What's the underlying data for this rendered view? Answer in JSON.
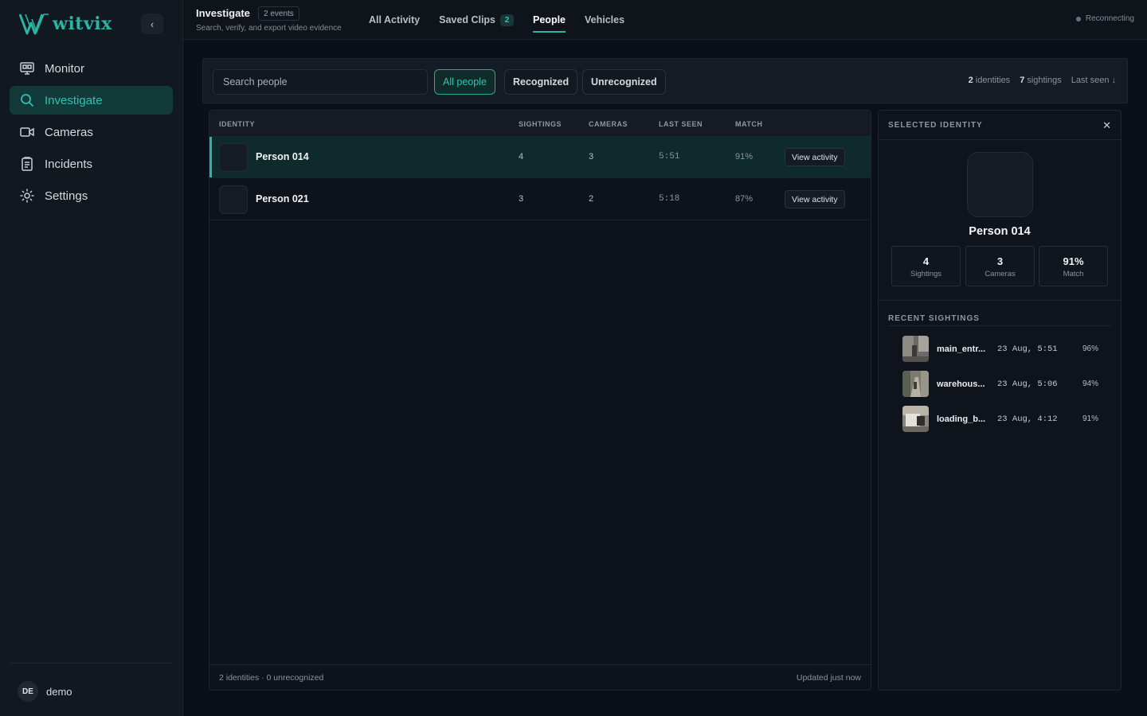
{
  "app": {
    "brand": "witvix"
  },
  "sidebar": {
    "items": [
      {
        "label": "Monitor",
        "icon": "monitor-icon"
      },
      {
        "label": "Investigate",
        "icon": "search-icon",
        "active": true
      },
      {
        "label": "Cameras",
        "icon": "camera-icon"
      },
      {
        "label": "Incidents",
        "icon": "clipboard-icon"
      },
      {
        "label": "Settings",
        "icon": "gear-icon"
      }
    ],
    "user": {
      "initials": "DE",
      "name": "demo"
    }
  },
  "header": {
    "title": "Investigate",
    "events_badge": "2 events",
    "subtitle": "Search, verify, and export video evidence",
    "tabs": [
      {
        "label": "All Activity"
      },
      {
        "label": "Saved Clips",
        "count": "2"
      },
      {
        "label": "People",
        "active": true
      },
      {
        "label": "Vehicles"
      }
    ],
    "status": "Reconnecting"
  },
  "filters": {
    "search_placeholder": "Search people",
    "search_value": "",
    "options": [
      "All people",
      "Recognized",
      "Unrecognized"
    ],
    "active": "All people",
    "summary": {
      "identities_count": "2",
      "identities_label": "identities",
      "sightings_count": "7",
      "sightings_label": "sightings",
      "sort": "Last seen ↓"
    }
  },
  "table": {
    "headers": {
      "identity": "IDENTITY",
      "sightings": "SIGHTINGS",
      "cameras": "CAMERAS",
      "last_seen": "LAST SEEN",
      "match": "MATCH"
    },
    "rows": [
      {
        "name": "Person 014",
        "sightings": "4",
        "cameras": "3",
        "last_seen": "5:51",
        "match": "91%",
        "action": "View activity",
        "selected": true
      },
      {
        "name": "Person 021",
        "sightings": "3",
        "cameras": "2",
        "last_seen": "5:18",
        "match": "87%",
        "action": "View activity",
        "selected": false
      }
    ],
    "footer_left": "2 identities · 0 unrecognized",
    "footer_right": "Updated just now"
  },
  "detail": {
    "title": "SELECTED IDENTITY",
    "name": "Person 014",
    "stats": [
      {
        "value": "4",
        "label": "Sightings"
      },
      {
        "value": "3",
        "label": "Cameras"
      },
      {
        "value": "91%",
        "label": "Match"
      }
    ],
    "recent_title": "RECENT SIGHTINGS",
    "sightings": [
      {
        "camera": "main_entr...",
        "time": "23 Aug, 5:51",
        "match": "96%"
      },
      {
        "camera": "warehous...",
        "time": "23 Aug, 5:06",
        "match": "94%"
      },
      {
        "camera": "loading_b...",
        "time": "23 Aug, 4:12",
        "match": "91%"
      }
    ]
  },
  "colors": {
    "accent": "#2bb3a3",
    "background": "#0b0f17",
    "sidebar": "#111820",
    "selected_row": "#0f2a2b"
  }
}
